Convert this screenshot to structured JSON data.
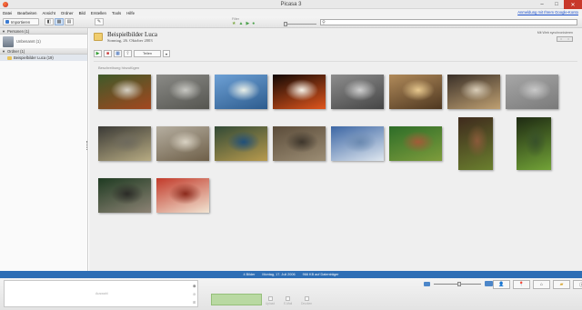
{
  "window": {
    "title": "Picasa 3"
  },
  "menu": {
    "items": [
      "Datei",
      "Bearbeiten",
      "Ansicht",
      "Ordner",
      "Bild",
      "Erstellen",
      "Tools",
      "Hilfe"
    ],
    "signin": "Anmeldung mit Ihrem Google-Konto"
  },
  "toolbar": {
    "import_label": "Importieren",
    "filter_label": "Filter",
    "search_placeholder": ""
  },
  "sidebar": {
    "sections": [
      {
        "label": "Personen (1)"
      },
      {
        "label": "Ordner (1)"
      }
    ],
    "person": "Unbenannt (1)",
    "folder": "Beispielbilder Luca (19)"
  },
  "album": {
    "title": "Beispielbilder Luca",
    "date": "Sonntag, 26. Oktober 2003",
    "web_sync": "Mit Web synchronisieren",
    "description": "Beschreibung hinzufügen",
    "share_label": "Teilen"
  },
  "status": {
    "count": "4 Bilder",
    "date": "Montag, 17. Juli 2006",
    "size": "966 KB auf Datenträger"
  },
  "tray": {
    "hold_label": "Auswahl",
    "tools": [
      "Upload",
      "E-Mail",
      "Drucken"
    ]
  },
  "colors": {
    "accent": "#2e6eb5"
  },
  "thumbnails": [
    {
      "name": "red-panda",
      "c1": "#3f5a2a",
      "c2": "#a3471f",
      "c3": "#d5d0c4"
    },
    {
      "name": "elephant",
      "c1": "#8a8a86",
      "c2": "#555550",
      "c3": "#c7c7c2"
    },
    {
      "name": "lake-mountains",
      "c1": "#6da0d5",
      "c2": "#2d5c8e",
      "c3": "#e9efe8"
    },
    {
      "name": "candle-fire",
      "c1": "#120905",
      "c2": "#e0551c",
      "c3": "#f7f2e8"
    },
    {
      "name": "lake-winter",
      "c1": "#8d8d8d",
      "c2": "#454545",
      "c3": "#cfcfcf"
    },
    {
      "name": "city-street",
      "c1": "#b08a5a",
      "c2": "#4e3720",
      "c3": "#e8c98f"
    },
    {
      "name": "arcade-portrait",
      "c1": "#3a3028",
      "c2": "#bfa072",
      "c3": "#d9cdb8"
    },
    {
      "name": "fog",
      "c1": "#a7a7a7",
      "c2": "#7a7a7a",
      "c3": "#c9c9c9"
    },
    {
      "name": "sunset-water",
      "c1": "#3b3a36",
      "c2": "#b7ab82",
      "c3": "#6e6a5d"
    },
    {
      "name": "duck-head",
      "c1": "#b5aea0",
      "c2": "#6e5f48",
      "c3": "#d9d2c3"
    },
    {
      "name": "peacock",
      "c1": "#324a36",
      "c2": "#b89a4d",
      "c3": "#1f4f7a"
    },
    {
      "name": "otter-water",
      "c1": "#5b4c3a",
      "c2": "#9c8d74",
      "c3": "#3e362c"
    },
    {
      "name": "bird-branch",
      "c1": "#3c66a4",
      "c2": "#dfe7ef",
      "c3": "#6a89b0"
    },
    {
      "name": "frog-leaf",
      "c1": "#2d6d28",
      "c2": "#7e9c3c",
      "c3": "#a35b38"
    },
    {
      "name": "lizard-green-1",
      "c1": "#3f2a1d",
      "c2": "#6a7f2e",
      "c3": "#8a5a3a"
    },
    {
      "name": "lizard-green-2",
      "c1": "#1e2a13",
      "c2": "#72a337",
      "c3": "#38512a"
    },
    {
      "name": "vulture",
      "c1": "#1f3b22",
      "c2": "#8c8274",
      "c3": "#2b2b27"
    },
    {
      "name": "food-plate",
      "c1": "#c23a2a",
      "c2": "#f1e4d2",
      "c3": "#8b2a1c"
    }
  ]
}
